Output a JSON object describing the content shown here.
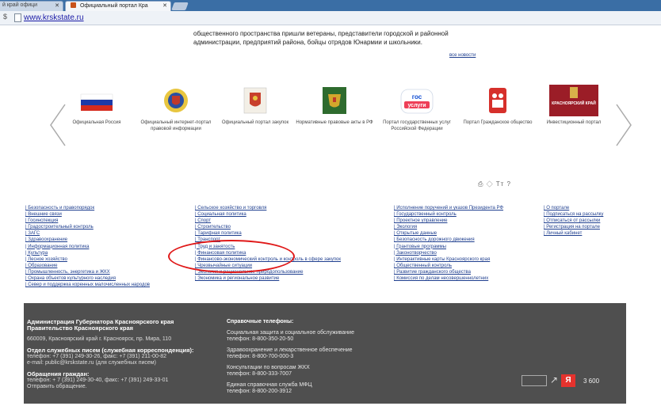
{
  "browser": {
    "tab1_label": "й край офици",
    "tab2_label": "Официальный портал Кра",
    "address": "www.krskstate.ru"
  },
  "news": {
    "line1": "общественного пространства пришли ветераны, представители городской и районной",
    "line2": "администрации, предприятий района, бойцы отрядов Юнармии и школьники.",
    "all_news": "все новости"
  },
  "banners": [
    {
      "caption": "Официальная Россия",
      "icon": "russian-flag-icon"
    },
    {
      "caption": "Официальный интернет-портал правовой информации",
      "icon": "coat-of-arms-icon"
    },
    {
      "caption": "Официальный портал закупок",
      "icon": "procurement-emblem-icon"
    },
    {
      "caption": "Нормативные правовые акты в РФ",
      "icon": "eagle-emblem-icon"
    },
    {
      "caption": "Портал государственных услуг Российской Федерации",
      "icon": "gosuslugi-icon"
    },
    {
      "caption": "Портал Гражданское общество",
      "icon": "civil-society-icon"
    },
    {
      "caption": "Инвестиционный портал",
      "icon": "krasnoyarsk-krai-icon"
    }
  ],
  "krai_logo_text": "КРАСНОЯРСКИЙ КРАЙ",
  "gos_logo_text": "гос услуги",
  "tools": "Tт ?",
  "links": {
    "col1": [
      "| Безопасность и правопорядок",
      "| Внешние связи",
      "| Госинспекция",
      "| Градостроительный контроль",
      "| ЗАГС",
      "| Здравоохранение",
      "| Информационная политика",
      "| Культура",
      "| Лесное хозяйство",
      "| Образование",
      "| Промышленность, энергетика и ЖКХ",
      "| Охрана объектов культурного наследия",
      "| Север и поддержка коренных малочисленных народов"
    ],
    "col2": [
      "| Сельское хозяйство и торговля",
      "| Социальная политика",
      "| Спорт",
      "| Строительство",
      "| Тарифная политика",
      "| Транспорт",
      "| Труд и занятость",
      "| Финансовая политика",
      "| Финансово-экономический контроль и контроль в сфере закупок",
      "| Чрезвычайные ситуации",
      "| Экология и рациональное природопользование",
      "| Экономика и региональное развитие"
    ],
    "col3": [
      "| Исполнение поручений и указов Президента РФ",
      "| Государственный контроль",
      "| Проектное управление",
      "| Экология",
      "| Открытые данные",
      "| Безопасность дорожного движения",
      "| Грантовые программы",
      "| Законотворчество",
      "| Интерактивные карты Красноярского края",
      "| Общественный контроль",
      "| Развитие гражданского общества",
      "| Комиссия по делам несовершеннолетних"
    ],
    "col4": [
      "| О портале",
      "| Подписаться на рассылку",
      "| Отписаться от рассылки",
      "| Регистрация на портале",
      "| Личный кабинет"
    ]
  },
  "footer": {
    "org1": "Администрация Губернатора Красноярского края",
    "org2": "Правительство Красноярского края",
    "address": "660009, Красноярский край г. Красноярск, пр. Мира, 110",
    "mail_title": "Отдел служебных писем (служебная корреспонденция):",
    "mail_phone": "телефон: +7 (391) 249-30-26, факс: +7 (391) 211-00-82",
    "mail_email": "e-mail: public@krskstate.ru (для служебных писем)",
    "citizens_title": "Обращения граждан:",
    "citizens_phone": "телефон: + 7 (391) 249-30-40, факс: +7 (391) 249-33-01",
    "citizens_send": "Отправить обращение.",
    "ref_title": "Справочные телефоны:",
    "ref1_name": "Социальная защита и социальное обслуживание",
    "ref1_phone": "телефон: 8-800-350-20-50",
    "ref2_name": "Здравоохранение и лекарственное обеспечение",
    "ref2_phone": "телефон: 8-800-700-000-3",
    "ref3_name": "Консультации по вопросам ЖКХ",
    "ref3_phone": "телефон: 8-800-333-7007",
    "ref4_name": "Единая справочная служба МФЦ",
    "ref4_phone": "телефон: 8-800-200-3912",
    "yandex_letter": "Я",
    "counter_value": "3 600"
  },
  "colors": {
    "accent_red": "#e01818",
    "link_blue": "#1f3f8f",
    "footer_bg": "#4f4f4f"
  }
}
